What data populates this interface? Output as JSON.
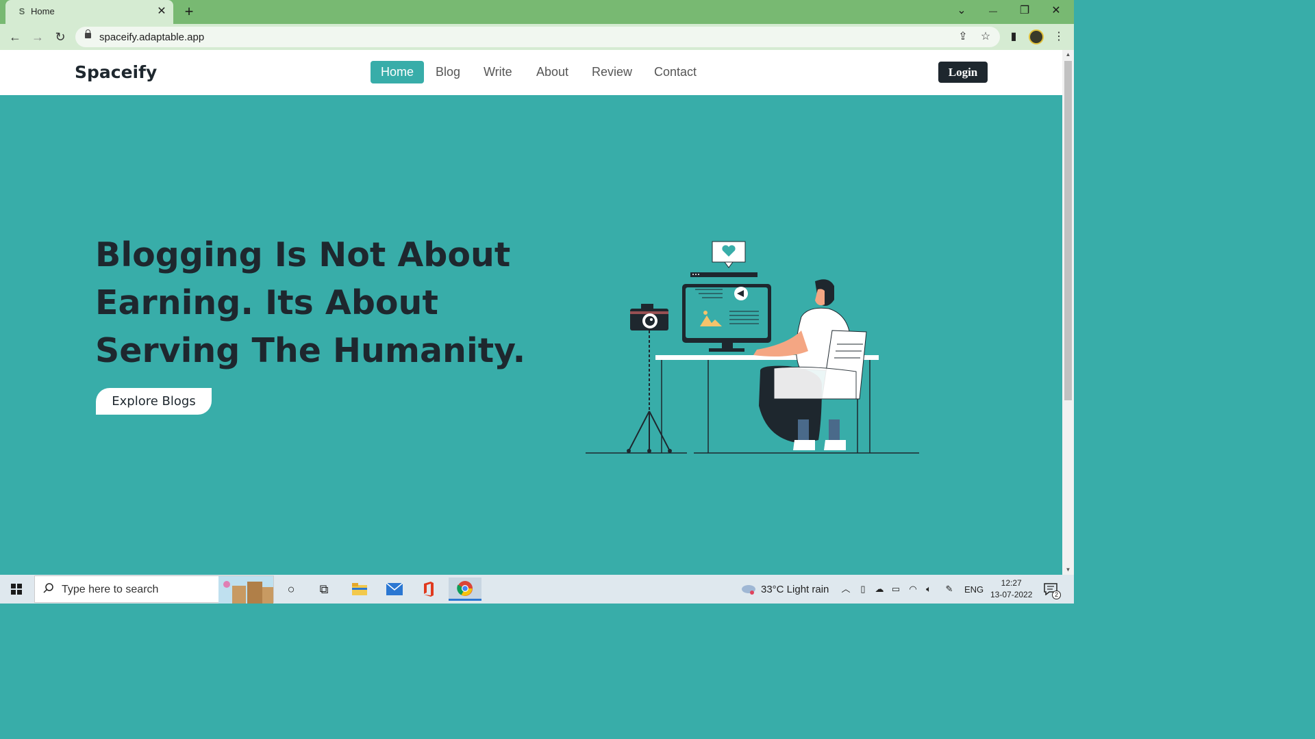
{
  "browser": {
    "tab_title": "Home",
    "tab_close": "✕",
    "new_tab": "+",
    "url": "spaceify.adaptable.app",
    "window_controls": {
      "chevron": "⌄",
      "minimize": "—",
      "restore": "❐",
      "close": "✕"
    },
    "nav": {
      "back": "←",
      "forward": "→",
      "reload": "↻"
    },
    "icons": {
      "share": "⇪",
      "star": "☆",
      "sidepanel": "▮",
      "menu": "⋮"
    }
  },
  "site": {
    "brand": "Spaceify",
    "menu": [
      "Home",
      "Blog",
      "Write",
      "About",
      "Review",
      "Contact"
    ],
    "active_menu": "Home",
    "login_label": "Login",
    "hero_title": "Blogging Is Not About Earning. Its About Serving The Humanity.",
    "cta_label": "Explore Blogs",
    "colors": {
      "accent": "#38ada9",
      "dark": "#1e272e",
      "white": "#ffffff"
    }
  },
  "taskbar": {
    "search_placeholder": "Type here to search",
    "weather": "33°C  Light rain",
    "language": "ENG",
    "time": "12:27",
    "date": "13-07-2022",
    "notification_count": "2",
    "apps": [
      "cortana-icon",
      "task-view-icon",
      "file-explorer-icon",
      "mail-icon",
      "office-icon",
      "chrome-icon"
    ]
  }
}
